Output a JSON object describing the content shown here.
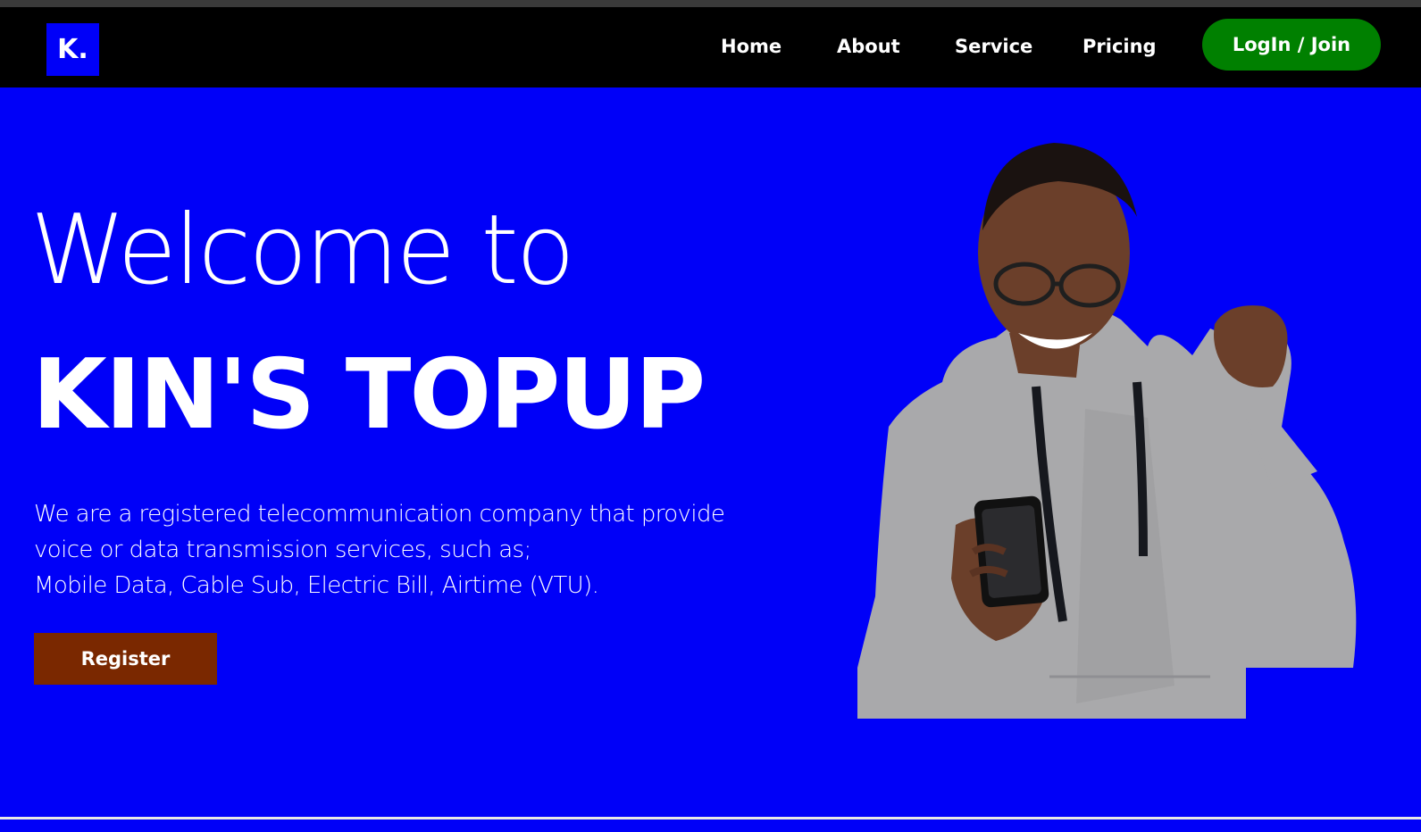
{
  "nav": {
    "logo_text": "K.",
    "links": [
      "Home",
      "About",
      "Service",
      "Pricing"
    ],
    "login_label": "LogIn / Join"
  },
  "hero": {
    "welcome": "Welcome to",
    "brand": "KIN'S TOPUP",
    "description_lines": [
      "We are a registered telecommunication company that provide",
      "voice or data transmission services, such as;",
      "Mobile Data, Cable Sub, Electric Bill, Airtime (VTU)."
    ],
    "register_label": "Register"
  },
  "colors": {
    "hero_background": "#0000f8",
    "nav_background": "#000000",
    "login_button": "#008000",
    "register_button": "#7a2800"
  },
  "icons": [
    "brand-logo-icon"
  ]
}
